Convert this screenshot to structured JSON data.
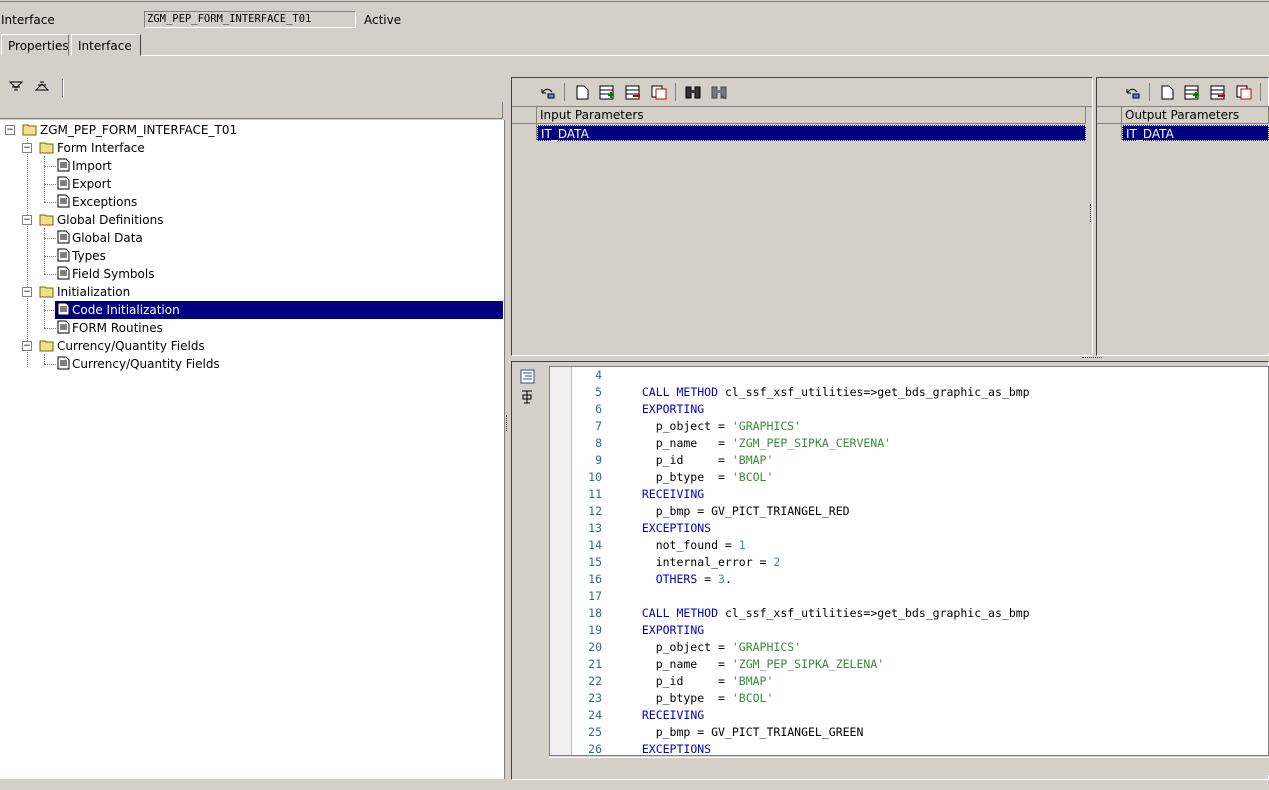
{
  "header": {
    "interface_label": "Interface",
    "interface_value": "ZGM_PEP_FORM_INTERFACE_T01",
    "status": "Active"
  },
  "tabs": [
    {
      "label": "Properties"
    },
    {
      "label": "Interface"
    }
  ],
  "active_tab": "Interface",
  "tree": {
    "root": "ZGM_PEP_FORM_INTERFACE_T01",
    "nodes": [
      {
        "label": "Form Interface"
      },
      {
        "label": "Import"
      },
      {
        "label": "Export"
      },
      {
        "label": "Exceptions"
      },
      {
        "label": "Global Definitions"
      },
      {
        "label": "Global Data"
      },
      {
        "label": "Types"
      },
      {
        "label": "Field Symbols"
      },
      {
        "label": "Initialization"
      },
      {
        "label": "Code Initialization"
      },
      {
        "label": "FORM Routines"
      },
      {
        "label": "Currency/Quantity Fields"
      },
      {
        "label": "Currency/Quantity Fields"
      }
    ],
    "selected": "Code Initialization"
  },
  "input_params": {
    "header": "Input Parameters",
    "rows": [
      "IT_DATA"
    ]
  },
  "output_params": {
    "header": "Output Parameters",
    "rows": [
      "IT_DATA"
    ]
  },
  "icons": {
    "left_toolbar": [
      "expand-all-icon",
      "collapse-all-icon"
    ],
    "grid_toolbar": [
      "undo-icon",
      "new-row-icon",
      "insert-row-icon",
      "delete-row-icon",
      "copy-row-icon",
      "find-icon",
      "find-next-icon"
    ],
    "editor": [
      "pretty-printer-icon",
      "settings-icon"
    ]
  },
  "code": [
    {
      "n": "4",
      "t": ""
    },
    {
      "n": "5",
      "t": "  CALL METHOD cl_ssf_xsf_utilities=>get_bds_graphic_as_bmp"
    },
    {
      "n": "6",
      "t": "  EXPORTING"
    },
    {
      "n": "7",
      "t": "    p_object = 'GRAPHICS'"
    },
    {
      "n": "8",
      "t": "    p_name   = 'ZGM_PEP_SIPKA_CERVENA'"
    },
    {
      "n": "9",
      "t": "    p_id     = 'BMAP'"
    },
    {
      "n": "10",
      "t": "    p_btype  = 'BCOL'"
    },
    {
      "n": "11",
      "t": "  RECEIVING"
    },
    {
      "n": "12",
      "t": "    p_bmp = GV_PICT_TRIANGEL_RED"
    },
    {
      "n": "13",
      "t": "  EXCEPTIONS"
    },
    {
      "n": "14",
      "t": "    not_found = 1"
    },
    {
      "n": "15",
      "t": "    internal_error = 2"
    },
    {
      "n": "16",
      "t": "    OTHERS = 3."
    },
    {
      "n": "17",
      "t": ""
    },
    {
      "n": "18",
      "t": "  CALL METHOD cl_ssf_xsf_utilities=>get_bds_graphic_as_bmp"
    },
    {
      "n": "19",
      "t": "  EXPORTING"
    },
    {
      "n": "20",
      "t": "    p_object = 'GRAPHICS'"
    },
    {
      "n": "21",
      "t": "    p_name   = 'ZGM_PEP_SIPKA_ZELENA'"
    },
    {
      "n": "22",
      "t": "    p_id     = 'BMAP'"
    },
    {
      "n": "23",
      "t": "    p_btype  = 'BCOL'"
    },
    {
      "n": "24",
      "t": "  RECEIVING"
    },
    {
      "n": "25",
      "t": "    p_bmp = GV_PICT_TRIANGEL_GREEN"
    },
    {
      "n": "26",
      "t": "  EXCEPTIONS"
    }
  ],
  "colors": {
    "selection": "#000080",
    "keyword": "#0000c0",
    "string": "#3a8a3a",
    "number": "#2f8fcf",
    "line_number": "#2b6b8a"
  }
}
